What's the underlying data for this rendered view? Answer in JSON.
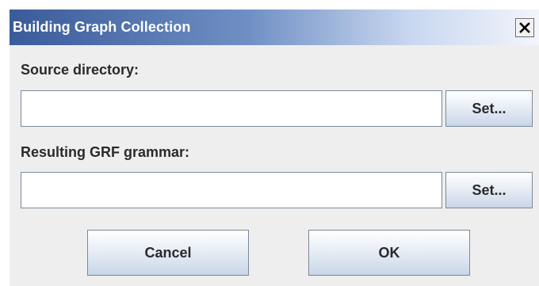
{
  "window": {
    "title": "Building Graph Collection",
    "close_icon": "close-icon"
  },
  "source": {
    "label": "Source directory:",
    "value": "",
    "set_label": "Set..."
  },
  "result": {
    "label": "Resulting GRF grammar:",
    "value": "",
    "set_label": "Set..."
  },
  "actions": {
    "cancel_label": "Cancel",
    "ok_label": "OK"
  },
  "colors": {
    "titlebar_start": "#3a5b9a",
    "titlebar_end": "#f2f5fb",
    "dialog_bg": "#eeeeee"
  }
}
